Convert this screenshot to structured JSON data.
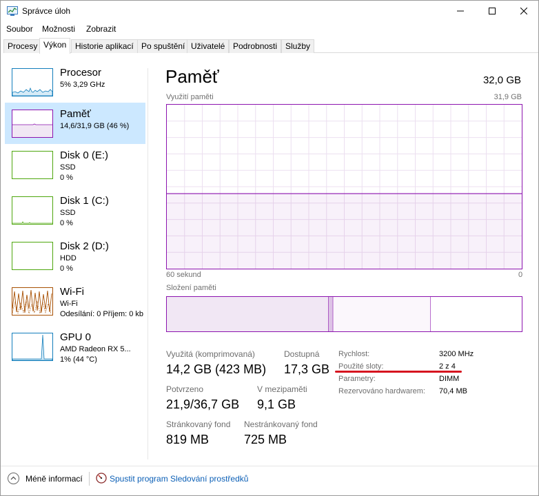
{
  "window": {
    "title": "Správce úloh"
  },
  "menu": [
    "Soubor",
    "Možnosti",
    "Zobrazit"
  ],
  "tabs": [
    "Procesy",
    "Výkon",
    "Historie aplikací",
    "Po spuštění",
    "Uživatelé",
    "Podrobnosti",
    "Služby"
  ],
  "active_tab": "Výkon",
  "sidebar": {
    "items": [
      {
        "name": "Procesor",
        "sub1": "5%  3,29 GHz",
        "sub2": "",
        "color": "#117dbb"
      },
      {
        "name": "Paměť",
        "sub1": "14,6/31,9 GB (46 %)",
        "sub2": "",
        "color": "#8b12ae"
      },
      {
        "name": "Disk 0 (E:)",
        "sub1": "SSD",
        "sub2": "0 %",
        "color": "#4da60c"
      },
      {
        "name": "Disk 1 (C:)",
        "sub1": "SSD",
        "sub2": "0 %",
        "color": "#4da60c"
      },
      {
        "name": "Disk 2 (D:)",
        "sub1": "HDD",
        "sub2": "0 %",
        "color": "#4da60c"
      },
      {
        "name": "Wi-Fi",
        "sub1": "Wi-Fi",
        "sub2": "Odesílání: 0 Příjem: 0 kb",
        "color": "#a74f01"
      },
      {
        "name": "GPU 0",
        "sub1": "AMD Radeon RX 5...",
        "sub2": "1% (44 °C)",
        "color": "#117dbb"
      }
    ],
    "active_index": 1
  },
  "main": {
    "title": "Paměť",
    "total": "32,0 GB",
    "usage_label": "Využití paměti",
    "usage_max": "31,9 GB",
    "time_label": "60 sekund",
    "time_zero": "0",
    "composition_label": "Složení paměti",
    "accent": "#8b12ae"
  },
  "stats": {
    "in_use_label": "Využitá (komprimovaná)",
    "in_use_value": "14,2 GB (423 MB)",
    "available_label": "Dostupná",
    "available_value": "17,3 GB",
    "committed_label": "Potvrzeno",
    "committed_value": "21,9/36,7 GB",
    "cached_label": "V mezipaměti",
    "cached_value": "9,1 GB",
    "paged_label": "Stránkovaný fond",
    "paged_value": "819 MB",
    "nonpaged_label": "Nestránkovaný fond",
    "nonpaged_value": "725 MB"
  },
  "details": [
    {
      "label": "Rychlost:",
      "value": "3200 MHz"
    },
    {
      "label": "Použité sloty:",
      "value": "2 z 4"
    },
    {
      "label": "Parametry:",
      "value": "DIMM"
    },
    {
      "label": "Rezervováno hardwarem:",
      "value": "70,4 MB"
    }
  ],
  "footer": {
    "less_info": "Méně informací",
    "monitor_link": "Spustit program Sledování prostředků"
  },
  "chart_data": {
    "type": "area",
    "title": "Využití paměti",
    "xlabel": "60 sekund",
    "ylabel": "",
    "ylim": [
      0,
      31.9
    ],
    "x": [
      60,
      55,
      50,
      45,
      40,
      35,
      30,
      25,
      20,
      15,
      10,
      5,
      0
    ],
    "series": [
      {
        "values": [
          14.6,
          14.6,
          14.6,
          14.6,
          14.6,
          14.6,
          14.6,
          14.6,
          14.6,
          14.6,
          14.6,
          14.6,
          14.6
        ]
      }
    ],
    "grid": true
  },
  "composition": {
    "segments": [
      {
        "fraction": 0.455,
        "kind": "in-use"
      },
      {
        "fraction": 0.013,
        "kind": "modified"
      },
      {
        "fraction": 0.275,
        "kind": "standby"
      },
      {
        "fraction": 0.257,
        "kind": "free"
      }
    ]
  }
}
